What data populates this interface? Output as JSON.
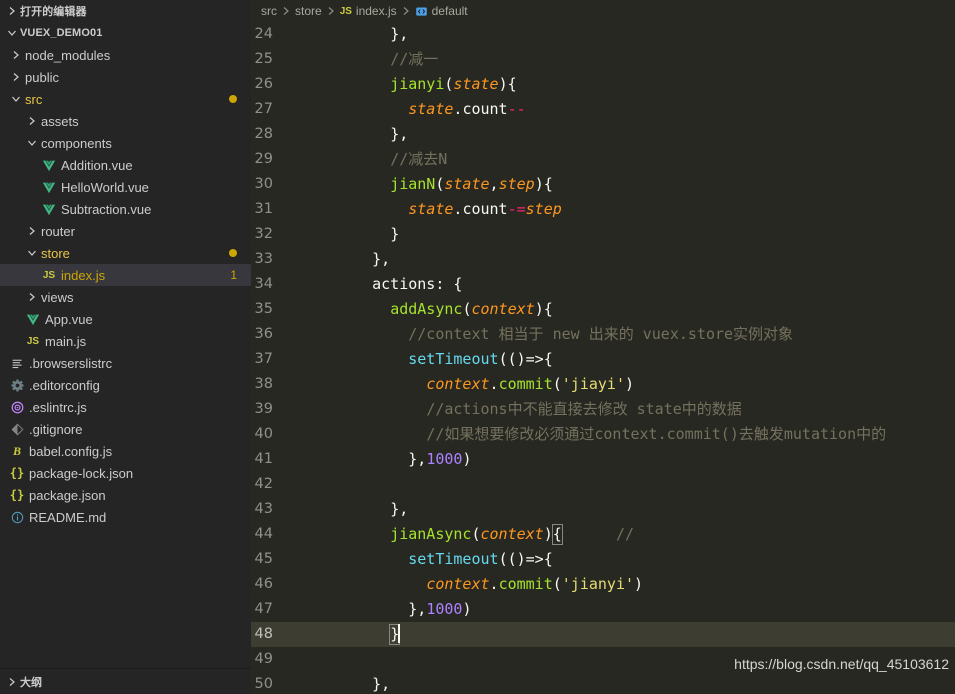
{
  "sidebar": {
    "open_editors_label": "打开的编辑器",
    "project_label": "VUEX_DEMO01",
    "outline_label": "大纲",
    "tree": [
      {
        "label": "node_modules",
        "depth": 1,
        "kind": "folder",
        "state": "collapsed"
      },
      {
        "label": "public",
        "depth": 1,
        "kind": "folder",
        "state": "collapsed"
      },
      {
        "label": "src",
        "depth": 1,
        "kind": "folder",
        "state": "expanded",
        "dirty": true,
        "dot": true
      },
      {
        "label": "assets",
        "depth": 2,
        "kind": "folder",
        "state": "collapsed"
      },
      {
        "label": "components",
        "depth": 2,
        "kind": "folder",
        "state": "expanded"
      },
      {
        "label": "Addition.vue",
        "depth": 3,
        "kind": "file",
        "icon": "vue-icon"
      },
      {
        "label": "HelloWorld.vue",
        "depth": 3,
        "kind": "file",
        "icon": "vue-icon"
      },
      {
        "label": "Subtraction.vue",
        "depth": 3,
        "kind": "file",
        "icon": "vue-icon"
      },
      {
        "label": "router",
        "depth": 2,
        "kind": "folder",
        "state": "collapsed"
      },
      {
        "label": "store",
        "depth": 2,
        "kind": "folder",
        "state": "expanded",
        "dirty": true,
        "dot": true
      },
      {
        "label": "index.js",
        "depth": 3,
        "kind": "file",
        "icon": "js-icon",
        "selected": true,
        "dirty": true,
        "badge": "1"
      },
      {
        "label": "views",
        "depth": 2,
        "kind": "folder",
        "state": "collapsed"
      },
      {
        "label": "App.vue",
        "depth": 2,
        "kind": "file",
        "icon": "vue-icon"
      },
      {
        "label": "main.js",
        "depth": 2,
        "kind": "file",
        "icon": "js-icon"
      },
      {
        "label": ".browserslistrc",
        "depth": 1,
        "kind": "file",
        "icon": "list-icon"
      },
      {
        "label": ".editorconfig",
        "depth": 1,
        "kind": "file",
        "icon": "gear-icon"
      },
      {
        "label": ".eslintrc.js",
        "depth": 1,
        "kind": "file",
        "icon": "eslint-icon"
      },
      {
        "label": ".gitignore",
        "depth": 1,
        "kind": "file",
        "icon": "diamond-icon"
      },
      {
        "label": "babel.config.js",
        "depth": 1,
        "kind": "file",
        "icon": "babel-icon"
      },
      {
        "label": "package-lock.json",
        "depth": 1,
        "kind": "file",
        "icon": "json-icon"
      },
      {
        "label": "package.json",
        "depth": 1,
        "kind": "file",
        "icon": "json-icon"
      },
      {
        "label": "README.md",
        "depth": 1,
        "kind": "file",
        "icon": "info-icon"
      }
    ]
  },
  "breadcrumbs": [
    {
      "label": "src",
      "icon": null
    },
    {
      "label": "store",
      "icon": null
    },
    {
      "label": "index.js",
      "icon": "js-icon"
    },
    {
      "label": "default",
      "icon": "symbol-object-icon"
    }
  ],
  "editor": {
    "first_line_number": 24,
    "active_line": 48,
    "watermark": "https://blog.csdn.net/qq_45103612",
    "lines": [
      {
        "n": 24,
        "tokens": [
          {
            "t": "      ",
            "c": "t-plain"
          },
          {
            "t": "},",
            "c": "t-punc"
          }
        ]
      },
      {
        "n": 25,
        "tokens": [
          {
            "t": "      ",
            "c": "t-plain"
          },
          {
            "t": "//减一",
            "c": "t-comment"
          }
        ]
      },
      {
        "n": 26,
        "tokens": [
          {
            "t": "      ",
            "c": "t-plain"
          },
          {
            "t": "jianyi",
            "c": "t-fn"
          },
          {
            "t": "(",
            "c": "t-punc"
          },
          {
            "t": "state",
            "c": "t-param"
          },
          {
            "t": "){",
            "c": "t-punc"
          }
        ]
      },
      {
        "n": 27,
        "tokens": [
          {
            "t": "        ",
            "c": "t-plain"
          },
          {
            "t": "state",
            "c": "t-param"
          },
          {
            "t": ".",
            "c": "t-punc"
          },
          {
            "t": "count",
            "c": "t-prop"
          },
          {
            "t": "--",
            "c": "t-op"
          }
        ]
      },
      {
        "n": 28,
        "tokens": [
          {
            "t": "      ",
            "c": "t-plain"
          },
          {
            "t": "},",
            "c": "t-punc"
          }
        ]
      },
      {
        "n": 29,
        "tokens": [
          {
            "t": "      ",
            "c": "t-plain"
          },
          {
            "t": "//减去N",
            "c": "t-comment"
          }
        ]
      },
      {
        "n": 30,
        "tokens": [
          {
            "t": "      ",
            "c": "t-plain"
          },
          {
            "t": "jianN",
            "c": "t-fn"
          },
          {
            "t": "(",
            "c": "t-punc"
          },
          {
            "t": "state",
            "c": "t-param"
          },
          {
            "t": ",",
            "c": "t-punc"
          },
          {
            "t": "step",
            "c": "t-param"
          },
          {
            "t": "){",
            "c": "t-punc"
          }
        ]
      },
      {
        "n": 31,
        "tokens": [
          {
            "t": "        ",
            "c": "t-plain"
          },
          {
            "t": "state",
            "c": "t-param"
          },
          {
            "t": ".",
            "c": "t-punc"
          },
          {
            "t": "count",
            "c": "t-prop"
          },
          {
            "t": "-=",
            "c": "t-op"
          },
          {
            "t": "step",
            "c": "t-param"
          }
        ]
      },
      {
        "n": 32,
        "tokens": [
          {
            "t": "      ",
            "c": "t-plain"
          },
          {
            "t": "}",
            "c": "t-punc"
          }
        ]
      },
      {
        "n": 33,
        "tokens": [
          {
            "t": "    ",
            "c": "t-plain"
          },
          {
            "t": "},",
            "c": "t-punc"
          }
        ]
      },
      {
        "n": 34,
        "tokens": [
          {
            "t": "    ",
            "c": "t-plain"
          },
          {
            "t": "actions",
            "c": "t-plain"
          },
          {
            "t": ": {",
            "c": "t-punc"
          }
        ]
      },
      {
        "n": 35,
        "tokens": [
          {
            "t": "      ",
            "c": "t-plain"
          },
          {
            "t": "addAsync",
            "c": "t-fn"
          },
          {
            "t": "(",
            "c": "t-punc"
          },
          {
            "t": "context",
            "c": "t-param"
          },
          {
            "t": "){",
            "c": "t-punc"
          }
        ]
      },
      {
        "n": 36,
        "tokens": [
          {
            "t": "        ",
            "c": "t-plain"
          },
          {
            "t": "//context 相当于 new 出来的 vuex.store实例对象",
            "c": "t-comment"
          }
        ]
      },
      {
        "n": 37,
        "tokens": [
          {
            "t": "        ",
            "c": "t-plain"
          },
          {
            "t": "setTimeout",
            "c": "t-builtin"
          },
          {
            "t": "(()=>{",
            "c": "t-punc"
          }
        ]
      },
      {
        "n": 38,
        "tokens": [
          {
            "t": "          ",
            "c": "t-plain"
          },
          {
            "t": "context",
            "c": "t-param"
          },
          {
            "t": ".",
            "c": "t-punc"
          },
          {
            "t": "commit",
            "c": "t-method"
          },
          {
            "t": "(",
            "c": "t-punc"
          },
          {
            "t": "'jiayi'",
            "c": "t-str"
          },
          {
            "t": ")",
            "c": "t-punc"
          }
        ]
      },
      {
        "n": 39,
        "tokens": [
          {
            "t": "          ",
            "c": "t-plain"
          },
          {
            "t": "//actions中不能直接去修改 state中的数据",
            "c": "t-comment"
          }
        ]
      },
      {
        "n": 40,
        "tokens": [
          {
            "t": "          ",
            "c": "t-plain"
          },
          {
            "t": "//如果想要修改必须通过context.commit()去触发mutation中的",
            "c": "t-comment"
          }
        ]
      },
      {
        "n": 41,
        "tokens": [
          {
            "t": "        ",
            "c": "t-plain"
          },
          {
            "t": "},",
            "c": "t-punc"
          },
          {
            "t": "1000",
            "c": "t-num"
          },
          {
            "t": ")",
            "c": "t-punc"
          }
        ]
      },
      {
        "n": 42,
        "tokens": []
      },
      {
        "n": 43,
        "tokens": [
          {
            "t": "      ",
            "c": "t-plain"
          },
          {
            "t": "},",
            "c": "t-punc"
          }
        ]
      },
      {
        "n": 44,
        "tokens": [
          {
            "t": "      ",
            "c": "t-plain"
          },
          {
            "t": "jianAsync",
            "c": "t-fn"
          },
          {
            "t": "(",
            "c": "t-punc"
          },
          {
            "t": "context",
            "c": "t-param"
          },
          {
            "t": ")",
            "c": "t-punc"
          },
          {
            "t": "{",
            "c": "t-punc",
            "match": true
          },
          {
            "t": "      ",
            "c": "t-plain"
          },
          {
            "t": "//",
            "c": "t-comment"
          }
        ]
      },
      {
        "n": 45,
        "tokens": [
          {
            "t": "        ",
            "c": "t-plain"
          },
          {
            "t": "setTimeout",
            "c": "t-builtin"
          },
          {
            "t": "(()=>{",
            "c": "t-punc"
          }
        ]
      },
      {
        "n": 46,
        "tokens": [
          {
            "t": "          ",
            "c": "t-plain"
          },
          {
            "t": "context",
            "c": "t-param"
          },
          {
            "t": ".",
            "c": "t-punc"
          },
          {
            "t": "commit",
            "c": "t-method"
          },
          {
            "t": "(",
            "c": "t-punc"
          },
          {
            "t": "'jianyi'",
            "c": "t-str"
          },
          {
            "t": ")",
            "c": "t-punc"
          }
        ]
      },
      {
        "n": 47,
        "tokens": [
          {
            "t": "        ",
            "c": "t-plain"
          },
          {
            "t": "},",
            "c": "t-punc"
          },
          {
            "t": "1000",
            "c": "t-num"
          },
          {
            "t": ")",
            "c": "t-punc"
          }
        ]
      },
      {
        "n": 48,
        "active": true,
        "tokens": [
          {
            "t": "      ",
            "c": "t-plain"
          },
          {
            "t": "}",
            "c": "t-punc",
            "match": true,
            "cursor": true
          }
        ]
      },
      {
        "n": 49,
        "tokens": []
      },
      {
        "n": 50,
        "tokens": [
          {
            "t": "    ",
            "c": "t-plain"
          },
          {
            "t": "},",
            "c": "t-punc"
          }
        ]
      }
    ]
  },
  "colors": {
    "sidebar_bg": "#252526",
    "editor_bg": "#272822",
    "selection_bg": "#37373d",
    "active_line_bg": "#3e3d32",
    "accent_yellow": "#cca700",
    "vue_green": "#41b883",
    "js_yellow": "#cbcb41"
  }
}
